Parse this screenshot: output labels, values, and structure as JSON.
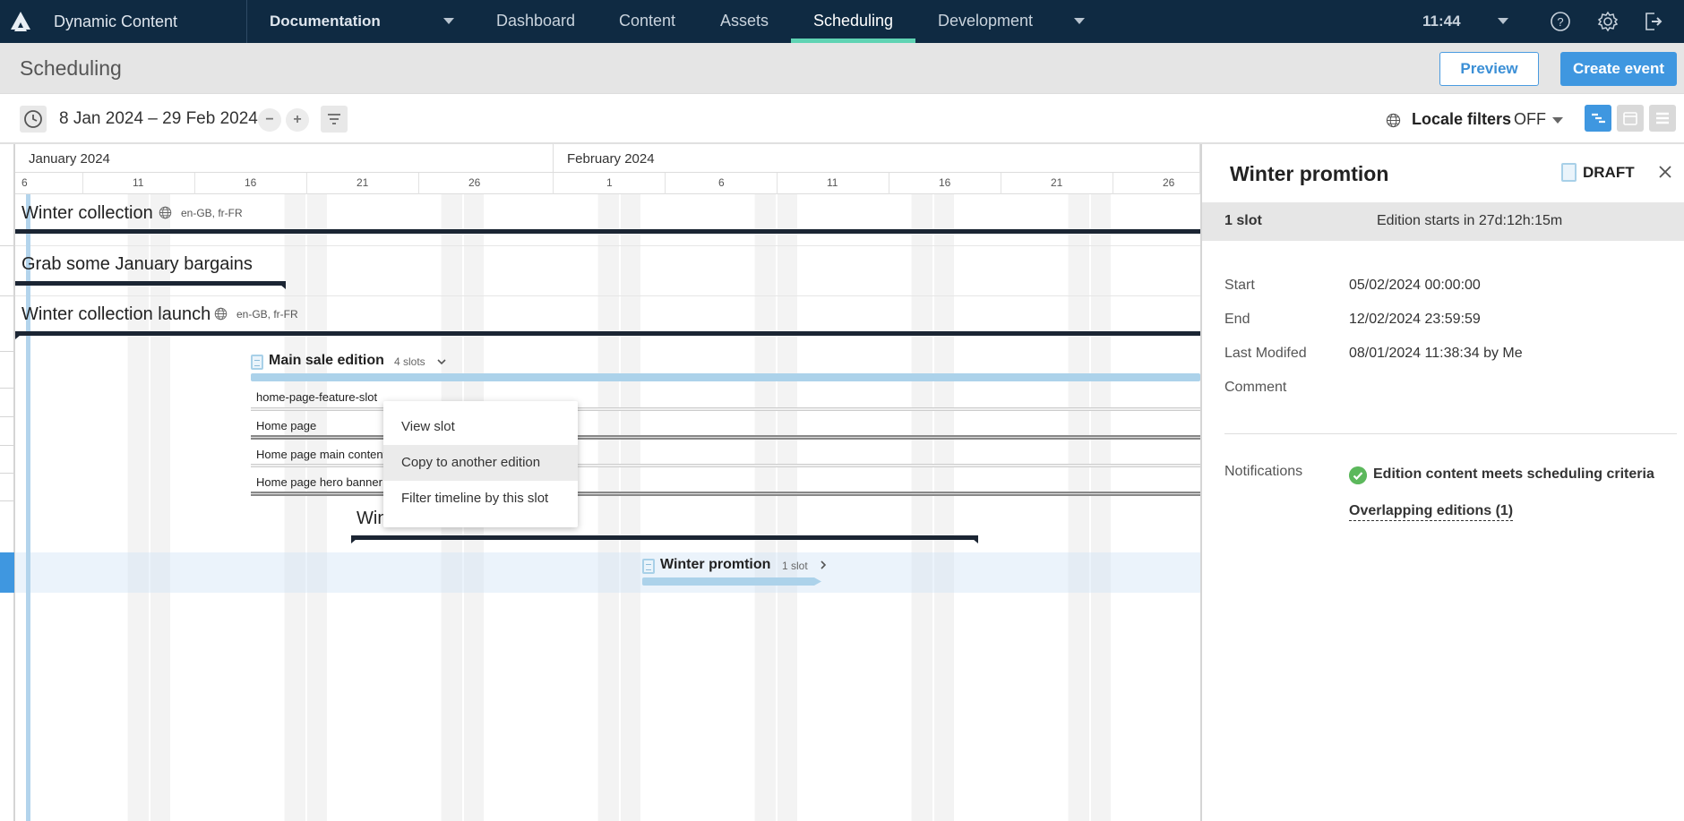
{
  "topnav": {
    "app_name": "Dynamic Content",
    "hub": "Documentation",
    "tabs": [
      {
        "label": "Dashboard",
        "active": false
      },
      {
        "label": "Content",
        "active": false
      },
      {
        "label": "Assets",
        "active": false
      },
      {
        "label": "Scheduling",
        "active": true
      },
      {
        "label": "Development",
        "active": false
      }
    ],
    "time": "11:44",
    "icons": [
      "help-icon",
      "settings-icon",
      "logout-icon"
    ]
  },
  "subheader": {
    "title": "Scheduling",
    "preview_label": "Preview",
    "create_label": "Create event"
  },
  "toolbar": {
    "date_range": "8 Jan 2024 – 29 Feb 2024",
    "zoom_out": "−",
    "zoom_in": "+",
    "locale_filters_label": "Locale filters",
    "locale_filters_value": "OFF",
    "views": [
      "timeline",
      "calendar",
      "list"
    ],
    "active_view": "timeline"
  },
  "timeline": {
    "months": [
      "January 2024",
      "February 2024"
    ],
    "days_jan": [
      "6",
      "11",
      "16",
      "21",
      "26"
    ],
    "days_feb": [
      "1",
      "6",
      "11",
      "16",
      "21",
      "26"
    ],
    "events": [
      {
        "title": "Winter collection",
        "locales": "en-GB, fr-FR"
      },
      {
        "title": "Grab some January bargains",
        "locales": ""
      },
      {
        "title": "Winter collection launch",
        "locales": "en-GB, fr-FR"
      }
    ],
    "editions": [
      {
        "title": "Main sale edition",
        "slots": "4 slots"
      },
      {
        "title": "Winter promtion",
        "slots": "1 slot"
      }
    ],
    "slots": [
      "home-page-feature-slot",
      "Home page",
      "Home page main content",
      "Home page hero banner"
    ],
    "partial_event_title": "Winter sale"
  },
  "context_menu": {
    "items": [
      {
        "label": "View slot",
        "hover": false
      },
      {
        "label": "Copy to another edition",
        "hover": true
      },
      {
        "label": "Filter timeline by this slot",
        "hover": false
      }
    ]
  },
  "panel": {
    "title": "Winter promtion",
    "status": "DRAFT",
    "slot_count": "1 slot",
    "countdown": "Edition starts in 27d:12h:15m",
    "fields": [
      {
        "label": "Start",
        "value": "05/02/2024 00:00:00"
      },
      {
        "label": "End",
        "value": "12/02/2024 23:59:59"
      },
      {
        "label": "Last Modifed",
        "value": "08/01/2024 11:38:34 by Me"
      },
      {
        "label": "Comment",
        "value": ""
      }
    ],
    "notifications_label": "Notifications",
    "notification": "Edition content meets scheduling criteria",
    "overlap_link": "Overlapping editions (1)"
  },
  "colors": {
    "nav_bg": "#0f2a42",
    "accent": "#3f97e0",
    "active_tab_underline": "#5fd3b3",
    "edition_bar": "#acd2ea",
    "event_bar": "#1b2533",
    "success": "#5cb85c"
  }
}
